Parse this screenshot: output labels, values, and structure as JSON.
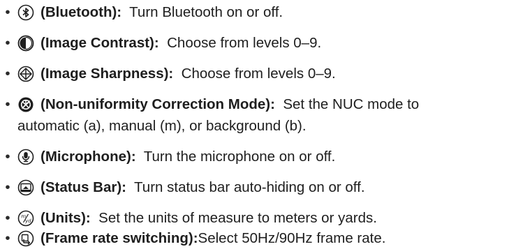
{
  "items": [
    {
      "icon": "bluetooth-icon",
      "label": "(Bluetooth):",
      "desc": "Turn Bluetooth on or off."
    },
    {
      "icon": "contrast-icon",
      "label": "(Image Contrast):",
      "desc": "Choose from levels 0–9."
    },
    {
      "icon": "sharpness-icon",
      "label": "(Image Sharpness):",
      "desc": "Choose from levels 0–9."
    },
    {
      "icon": "nuc-mode-icon",
      "label": "(Non-uniformity Correction Mode):",
      "desc": "Set the NUC mode to",
      "desc2": "automatic (a), manual (m), or background (b)."
    },
    {
      "icon": "microphone-icon",
      "label": "(Microphone):",
      "desc": "Turn the microphone on or off."
    },
    {
      "icon": "status-bar-icon",
      "label": "(Status Bar):",
      "desc": "Turn status bar auto-hiding on or off."
    },
    {
      "icon": "units-icon",
      "label": "(Units):",
      "desc": "Set the units of measure to meters or yards."
    },
    {
      "icon": "frame-rate-icon",
      "label": "(Frame rate switching):",
      "desc": "Select 50Hz/90Hz frame rate."
    }
  ],
  "bullet": "•"
}
